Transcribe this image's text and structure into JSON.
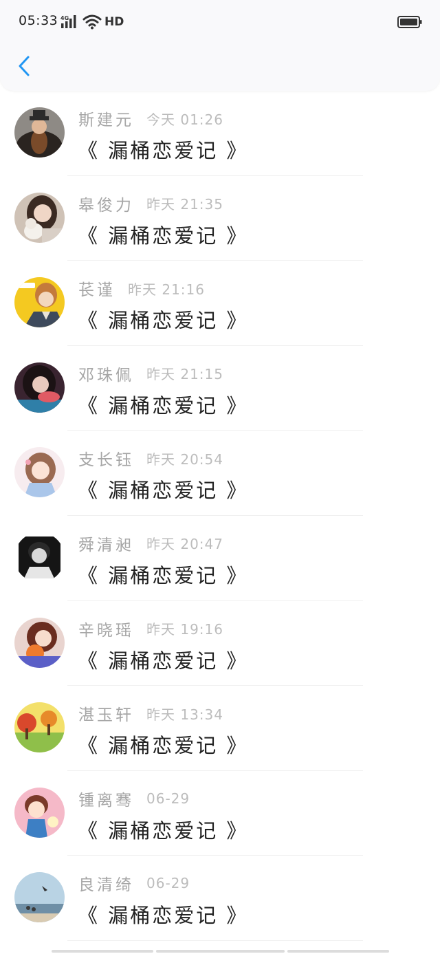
{
  "status_bar": {
    "time": "05:33",
    "network": "4G",
    "hd": "HD"
  },
  "header": {
    "back_icon": "chevron-left-icon",
    "accent_color": "#2196F3"
  },
  "comments": [
    {
      "name": "斯建元",
      "time": "今天 01:26",
      "title": "《 漏桶恋爱记 》"
    },
    {
      "name": "皋俊力",
      "time": "昨天 21:35",
      "title": "《 漏桶恋爱记 》"
    },
    {
      "name": "苌谨",
      "time": "昨天 21:16",
      "title": "《 漏桶恋爱记 》"
    },
    {
      "name": "邓珠佩",
      "time": "昨天 21:15",
      "title": "《 漏桶恋爱记 》"
    },
    {
      "name": "支长钰",
      "time": "昨天 20:54",
      "title": "《 漏桶恋爱记 》"
    },
    {
      "name": "舜清昶",
      "time": "昨天 20:47",
      "title": "《 漏桶恋爱记 》"
    },
    {
      "name": "辛晓瑶",
      "time": "昨天 19:16",
      "title": "《 漏桶恋爱记 》"
    },
    {
      "name": "湛玉轩",
      "time": "昨天 13:34",
      "title": "《 漏桶恋爱记 》"
    },
    {
      "name": "锺离骞",
      "time": "06-29",
      "title": "《 漏桶恋爱记 》"
    },
    {
      "name": "良清绮",
      "time": "06-29",
      "title": "《 漏桶恋爱记 》"
    }
  ]
}
